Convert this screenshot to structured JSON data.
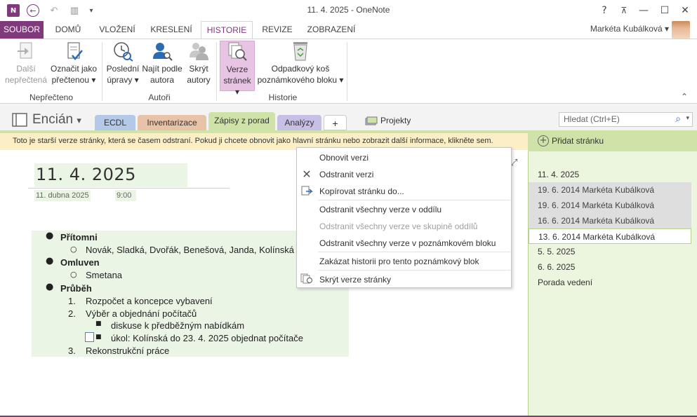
{
  "window": {
    "title": "11. 4. 2025 - OneNote",
    "help": "?",
    "ribbon_display": "⊼",
    "minimize": "—",
    "maximize": "☐",
    "close": "✕"
  },
  "quick_access": {
    "logo": "N",
    "back": "←",
    "undo": "↶",
    "dock": "▥",
    "customize": "▾"
  },
  "tabs": [
    "SOUBOR",
    "DOMŮ",
    "VLOŽENÍ",
    "KRESLENÍ",
    "HISTORIE",
    "REVIZE",
    "ZOBRAZENÍ"
  ],
  "active_tab": "HISTORIE",
  "user": {
    "name": "Markéta Kubálková",
    "dropdown": "▾"
  },
  "ribbon": {
    "next_unread": {
      "line1": "Další",
      "line2": "nepřečtená"
    },
    "mark_read": {
      "line1": "Označit jako",
      "line2": "přečtenou ▾"
    },
    "recent_edits": {
      "line1": "Poslední",
      "line2": "úpravy ▾"
    },
    "find_author": {
      "line1": "Najít podle",
      "line2": "autora"
    },
    "hide_authors": {
      "line1": "Skrýt",
      "line2": "autory"
    },
    "page_versions": {
      "line1": "Verze",
      "line2": "stránek ▾"
    },
    "recycle_bin": {
      "line1": "Odpadkový koš",
      "line2": "poznámkového bloku ▾"
    },
    "groups": {
      "unread": "Nepřečteno",
      "authors": "Autoři",
      "history": "Historie"
    },
    "collapse": "⌃"
  },
  "notebook": {
    "name": "Encián",
    "dropdown": "▾",
    "sections": [
      {
        "label": "ECDL",
        "color": "#b4c8e8"
      },
      {
        "label": "Inventarizace",
        "color": "#e8c3a8"
      },
      {
        "label": "Zápisy z porad",
        "color": "#cfe3a9"
      },
      {
        "label": "Analýzy",
        "color": "#c8bfe6"
      },
      {
        "label": "+",
        "color": "#ffffff"
      }
    ],
    "section_group": "Projekty",
    "search_placeholder": "Hledat (Ctrl+E)",
    "search_icon": "⌕"
  },
  "infobar": {
    "text": "Toto je starší verze stránky, která se časem odstraní. Pokud ji chcete obnovit jako hlavní stránku nebo zobrazit další informace, klikněte sem."
  },
  "page": {
    "title": "11. 4. 2025",
    "date": "11. dubna 2025",
    "time": "9:00",
    "expand_icon": "⤢",
    "outline": {
      "present_heading": "Přítomni",
      "present_names": "Novák, Sladká, Dvořák, Benešová, Janda, Kolínská",
      "excused_heading": "Omluven",
      "excused_name": "Smetana",
      "progress_heading": "Průběh",
      "item1_num": "1.",
      "item1": "Rozpočet a koncepce vybavení",
      "item2_num": "2.",
      "item2": "Výběr a objednání počítačů",
      "item2_sub": "diskuse k předběžným nabídkám",
      "item2_task": "úkol: Kolínská do 23. 4. 2025 objednat počítače",
      "item3_num": "3.",
      "item3": "Rekonstrukční práce"
    }
  },
  "pages_pane": {
    "add_page": "Přidat stránku",
    "add_icon": "+",
    "items": [
      "11. 4. 2025",
      "19. 6. 2014 Markéta Kubálková",
      "19. 6. 2014 Markéta Kubálková",
      "16. 6. 2014 Markéta Kubálková",
      "13. 6. 2014 Markéta Kubálková",
      "5. 5. 2025",
      "6. 6. 2025",
      "Porada vedení"
    ]
  },
  "context_menu": {
    "restore": "Obnovit verzi",
    "delete": "Odstranit verzi",
    "copy": "Kopírovat stránku do...",
    "delete_section": "Odstranit všechny verze v oddílu",
    "delete_group": "Odstranit všechny verze ve skupině oddílů",
    "delete_notebook": "Odstranit všechny verze v poznámkovém bloku",
    "disable_history": "Zakázat historii pro tento poznámkový blok",
    "hide_versions": "Skrýt verze stránky"
  }
}
